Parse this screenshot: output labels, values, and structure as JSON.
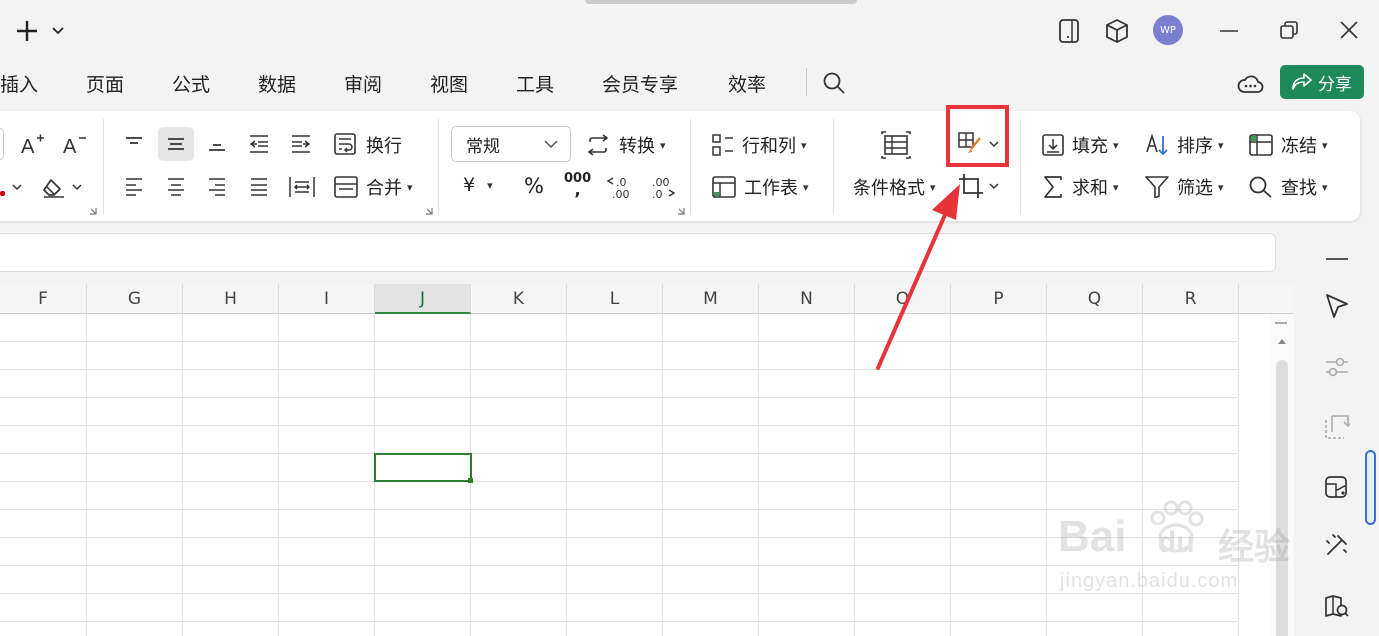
{
  "titlebar": {
    "avatar_text": "WP"
  },
  "menu": [
    "插入",
    "页面",
    "公式",
    "数据",
    "审阅",
    "视图",
    "工具",
    "会员专享",
    "效率"
  ],
  "share_label": "分享",
  "ribbon": {
    "wrap": "换行",
    "merge": "合并",
    "number_format": "常规",
    "convert": "转换",
    "currency": "¥",
    "percent": "%",
    "thousands": "000",
    "rows_cols": "行和列",
    "worksheet": "工作表",
    "cond_format": "条件格式",
    "fill": "填充",
    "sort": "排序",
    "freeze": "冻结",
    "sum": "求和",
    "filter": "筛选",
    "find": "查找"
  },
  "columns": [
    "F",
    "G",
    "H",
    "I",
    "J",
    "K",
    "L",
    "M",
    "N",
    "O",
    "P",
    "Q",
    "R"
  ],
  "selected_column": "J",
  "watermark": {
    "brand": "Bai",
    "brand2": "du",
    "cn": "经验",
    "url": "jingyan.baidu.com"
  }
}
